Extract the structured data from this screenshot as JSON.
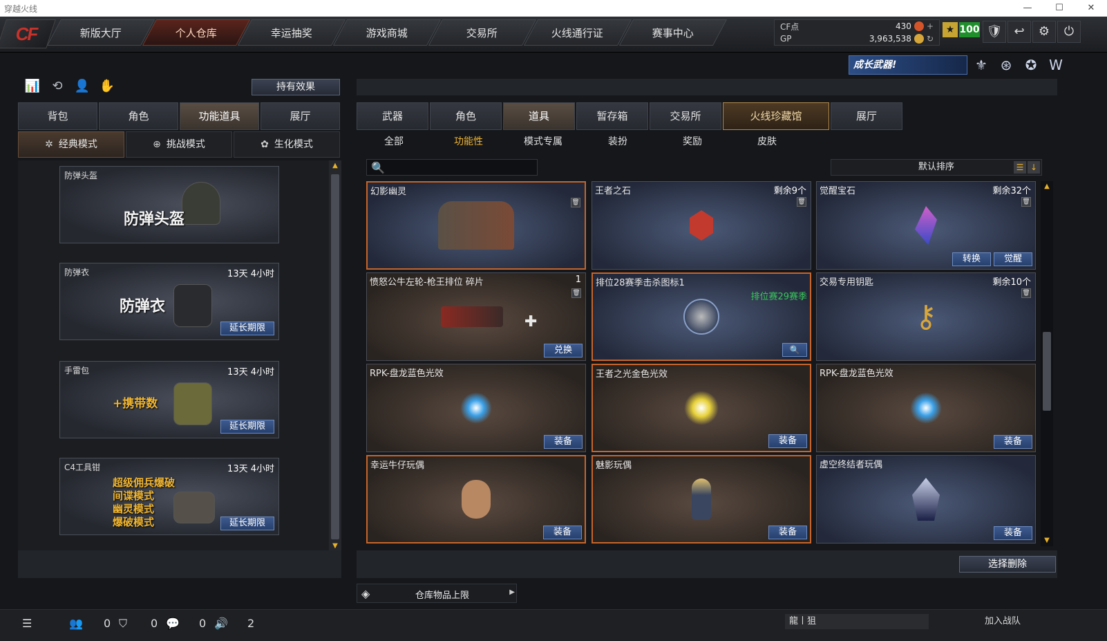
{
  "window": {
    "title": "穿越火线",
    "btn_min": "—",
    "btn_max": "☐",
    "btn_close": "✕"
  },
  "logo": "CF",
  "nav": [
    "新版大厅",
    "个人仓库",
    "幸运抽奖",
    "游戏商城",
    "交易所",
    "火线通行证",
    "赛事中心"
  ],
  "currency": {
    "cf_label": "CF点",
    "cf_value": "430",
    "gp_label": "GP",
    "gp_value": "3,963,538"
  },
  "level": "100",
  "top_icons": [
    "🛡",
    "↩",
    "⚙",
    "⏻"
  ],
  "banner": {
    "text": "成长武器!"
  },
  "emblems": [
    "⚜",
    "⊛",
    "✪",
    "W"
  ],
  "left": {
    "holding_btn": "持有效果",
    "tabs": [
      "背包",
      "角色",
      "功能道具",
      "展厅"
    ],
    "modes": [
      "经典模式",
      "挑战模式",
      "生化模式"
    ],
    "items": [
      {
        "name": "防弹头盔",
        "time": "",
        "art": "防弹头盔",
        "extend": ""
      },
      {
        "name": "防弹衣",
        "time": "13天 4小时",
        "art": "防弹衣",
        "extend": "延长期限"
      },
      {
        "name": "手雷包",
        "time": "13天 4小时",
        "art": "+携带数",
        "extend": "延长期限"
      },
      {
        "name": "C4工具钳",
        "time": "13天 4小时",
        "art1": "超级佣兵爆破",
        "art2": "间谍模式",
        "art3": "幽灵模式",
        "art4": "爆破模式",
        "extend": "延长期限"
      }
    ]
  },
  "right": {
    "tabs": [
      "武器",
      "角色",
      "道具",
      "暂存箱",
      "交易所",
      "火线珍藏馆",
      "展厅"
    ],
    "subtabs": [
      "全部",
      "功能性",
      "模式专属",
      "装扮",
      "奖励",
      "皮肤"
    ],
    "search_placeholder": "",
    "sort": "默认排序",
    "cards": [
      {
        "name": "幻影幽灵",
        "info": "",
        "btn": ""
      },
      {
        "name": "王者之石",
        "info": "剩余9个",
        "btn": ""
      },
      {
        "name": "觉醒宝石",
        "info": "剩余32个",
        "btn1": "转换",
        "btn2": "觉醒"
      },
      {
        "name": "愤怒公牛左轮-枪王排位 碎片",
        "info": "1",
        "btn": "兑换"
      },
      {
        "name": "排位28赛季击杀图标1",
        "info": "排位赛29赛季",
        "btn": "🔍"
      },
      {
        "name": "交易专用钥匙",
        "info": "剩余10个",
        "btn": ""
      },
      {
        "name": "RPK-盘龙蓝色光效",
        "info": "",
        "btn": "装备"
      },
      {
        "name": "王者之光金色光效",
        "info": "",
        "btn": "装备"
      },
      {
        "name": "RPK-盘龙蓝色光效",
        "info": "",
        "btn": "装备"
      },
      {
        "name": "幸运牛仔玩偶",
        "info": "",
        "btn": "装备"
      },
      {
        "name": "魅影玩偶",
        "info": "",
        "btn": "装备"
      },
      {
        "name": "虚空终结者玩偶",
        "info": "",
        "btn": "装备"
      }
    ],
    "delete_btn": "选择删除",
    "capacity": "仓库物品上限"
  },
  "status": {
    "c1": "0",
    "c2": "0",
    "c3": "0",
    "c4": "2",
    "clan": "龍丨狙",
    "join": "加入战队"
  }
}
